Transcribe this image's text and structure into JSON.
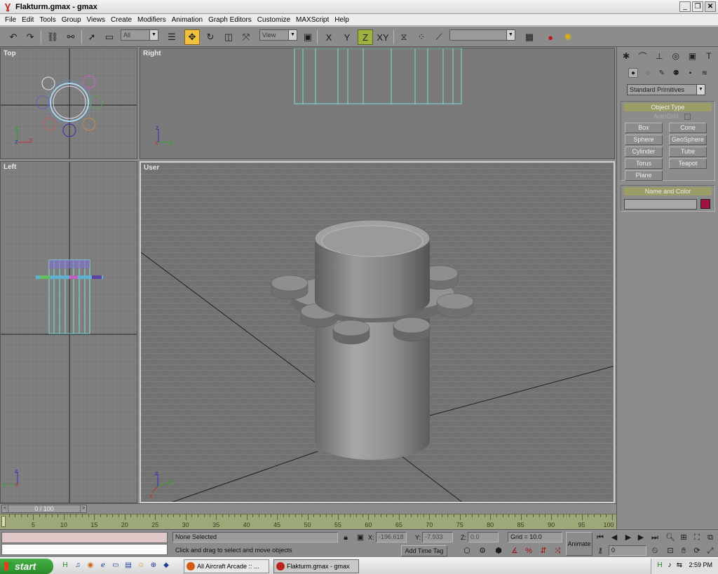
{
  "window": {
    "title": "Flakturm.gmax - gmax"
  },
  "menu": [
    "File",
    "Edit",
    "Tools",
    "Group",
    "Views",
    "Create",
    "Modifiers",
    "Animation",
    "Graph Editors",
    "Customize",
    "MAXScript",
    "Help"
  ],
  "toolbar": {
    "selection_filter": "All",
    "reference_coord": "View",
    "named_selection": "",
    "constraint_labels": [
      "X",
      "Y",
      "Z",
      "XY"
    ]
  },
  "viewports": {
    "top": "Top",
    "right": "Right",
    "left": "Left",
    "user": "User",
    "axis_x": "x",
    "axis_y": "y",
    "axis_z": "z"
  },
  "command_panel": {
    "category": "Standard Primitives",
    "object_type": {
      "title": "Object Type",
      "autogrid": "AutoGrid",
      "buttons": [
        "Box",
        "Cone",
        "Sphere",
        "GeoSphere",
        "Cylinder",
        "Tube",
        "Torus",
        "Teapot",
        "Plane"
      ]
    },
    "name_color": {
      "title": "Name and Color",
      "name": "",
      "color": "#a01040"
    }
  },
  "time_slider": {
    "label": "0 / 100"
  },
  "trackbar": {
    "ticks": [
      "5",
      "10",
      "15",
      "20",
      "25",
      "30",
      "35",
      "40",
      "45",
      "50",
      "55",
      "60",
      "65",
      "70",
      "75",
      "80",
      "85",
      "90",
      "95",
      "100"
    ]
  },
  "status": {
    "selection": "None Selected",
    "prompt": "Click and drag to select and move objects",
    "add_time_tag": "Add Time Tag",
    "x_label": "X:",
    "x_value": "-196.618",
    "y_label": "Y:",
    "y_value": "-7.933",
    "z_label": "Z:",
    "z_value": "0.0",
    "grid": "Grid = 10.0",
    "animate": "Animate",
    "frame": "0"
  },
  "taskbar": {
    "start": "start",
    "items": [
      "All Aircraft Arcade :: ...",
      "Flakturm.gmax - gmax"
    ],
    "clock": "2:59 PM"
  }
}
